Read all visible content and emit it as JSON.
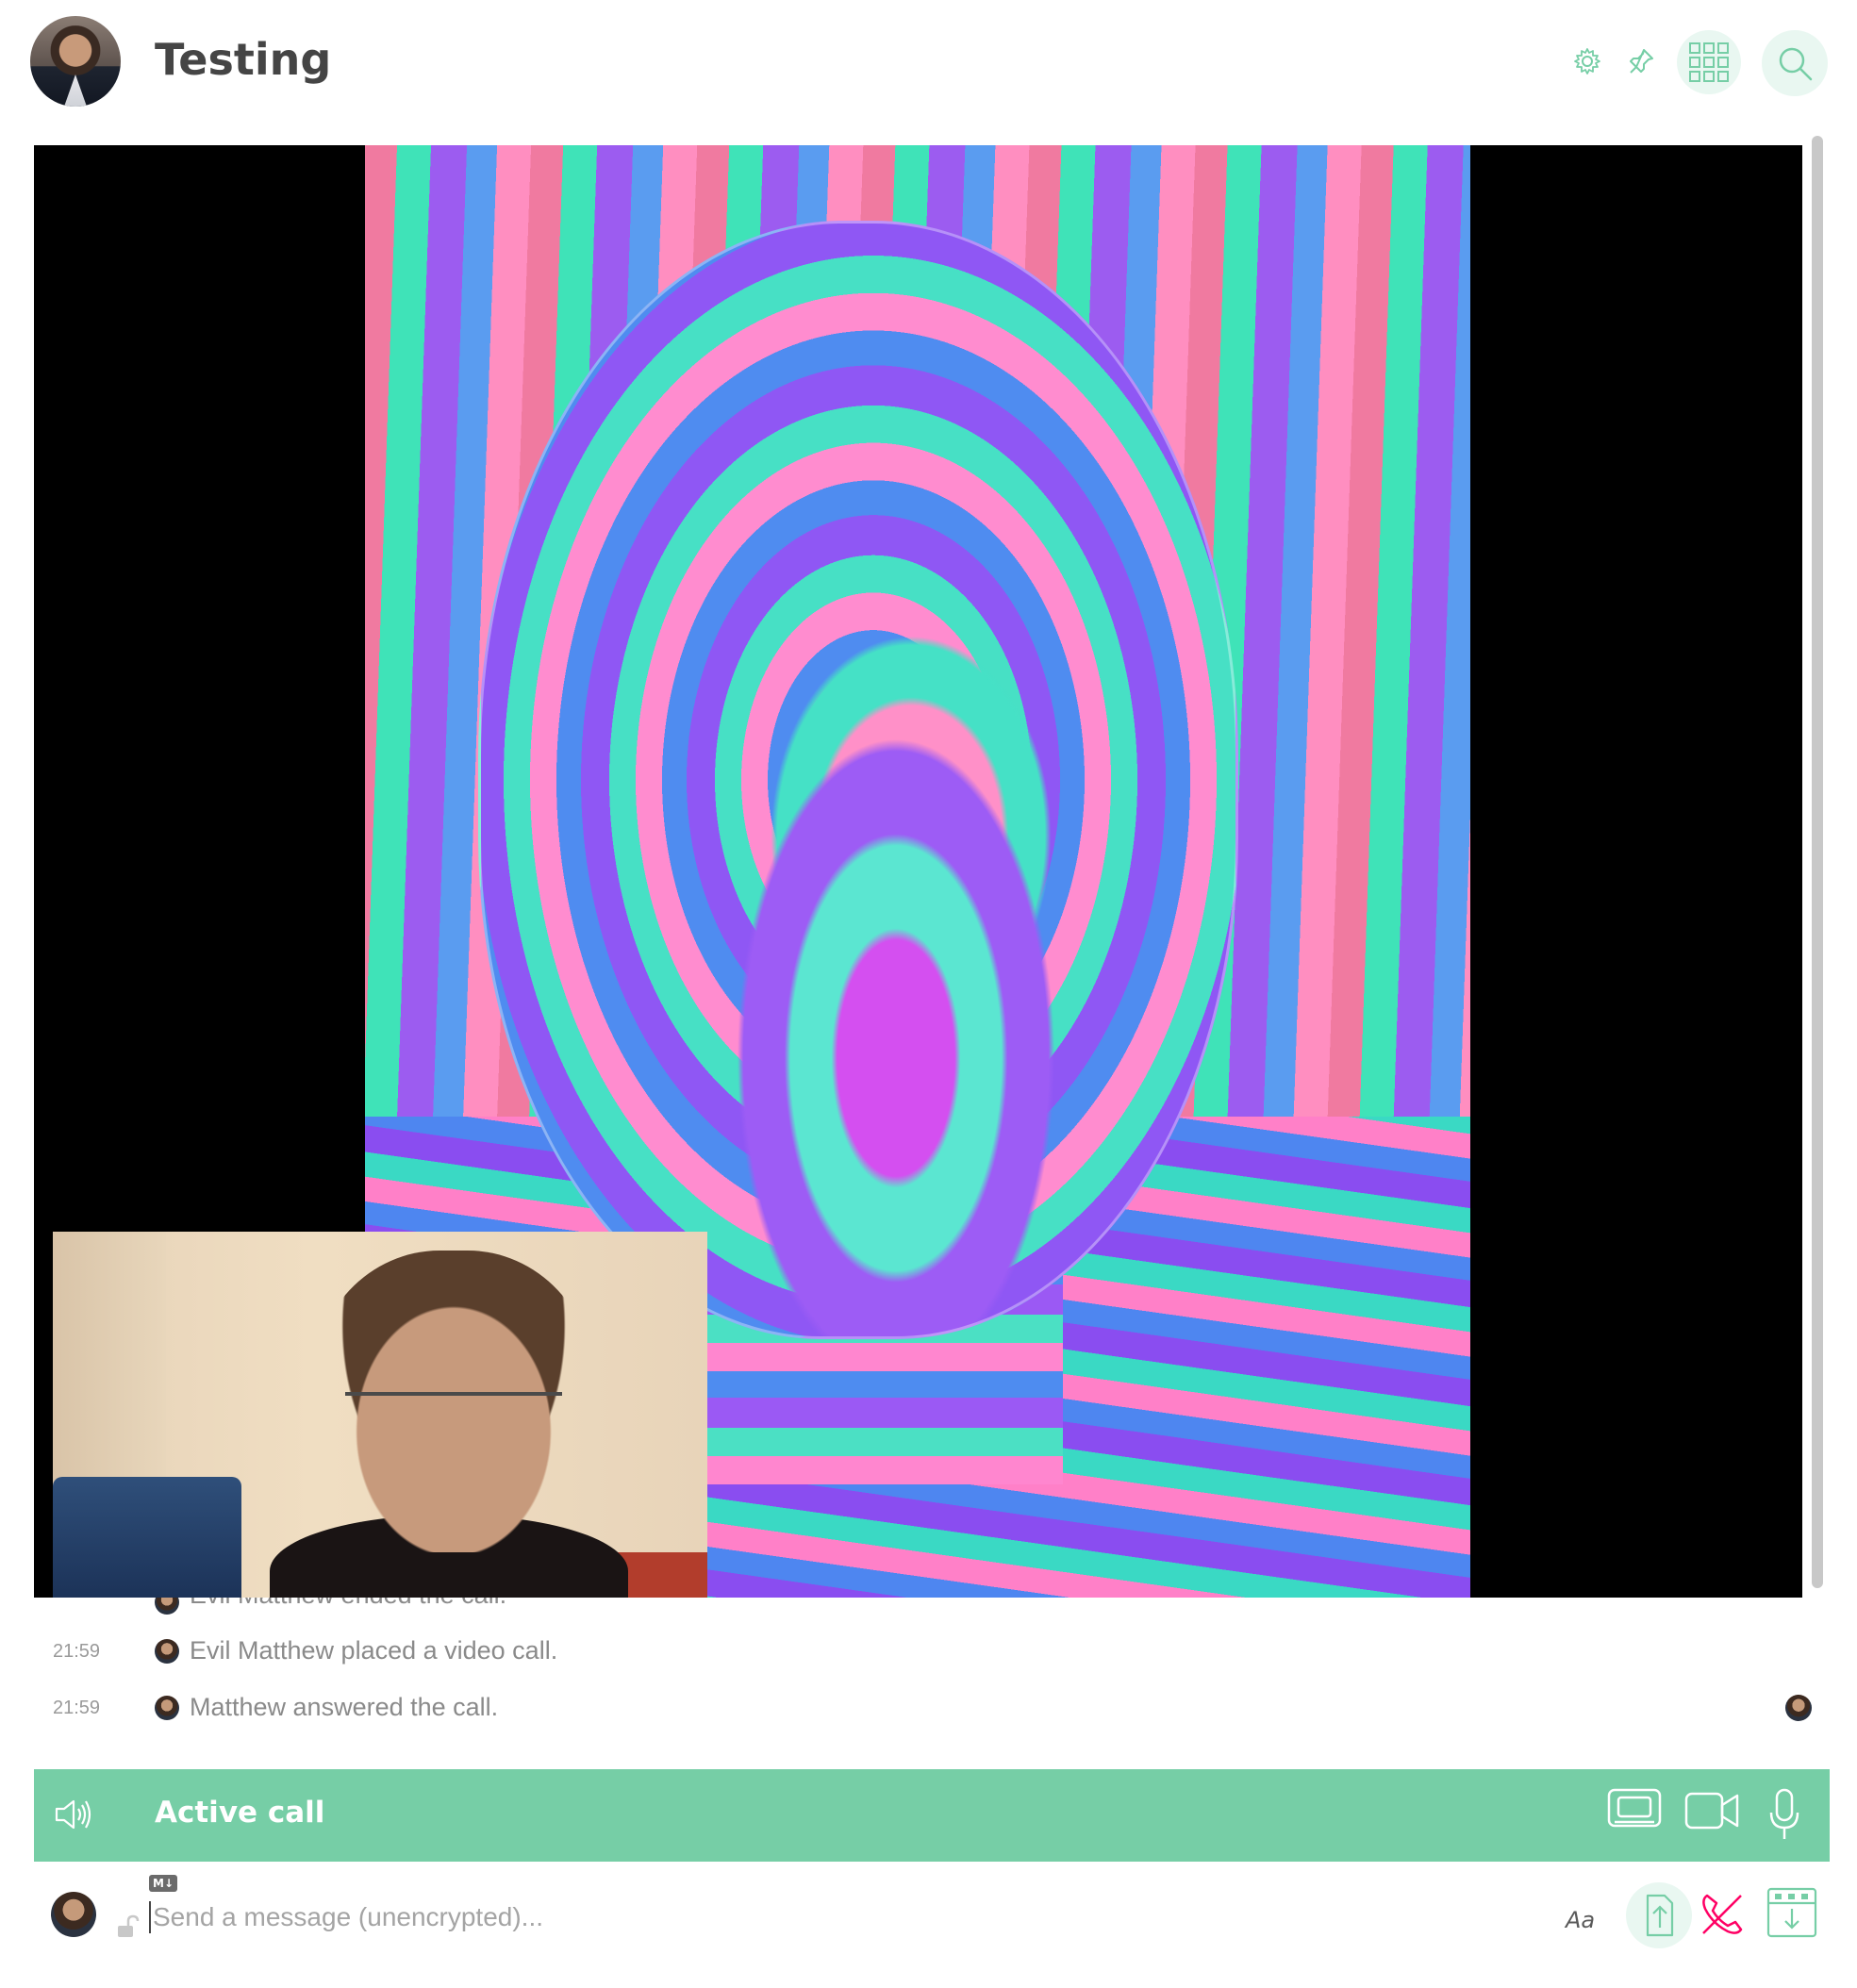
{
  "header": {
    "room_name": "Testing"
  },
  "timeline": {
    "partial_message": "Evil Matthew ended the call.",
    "events": [
      {
        "time": "21:59",
        "text": "Evil Matthew placed a video call."
      },
      {
        "time": "21:59",
        "text": "Matthew answered the call."
      }
    ]
  },
  "call_bar": {
    "label": "Active call"
  },
  "composer": {
    "placeholder": "Send a message (unencrypted)...",
    "markdown_badge": "M↓",
    "format_label": "Aa"
  },
  "colors": {
    "accent": "#76cea6",
    "accent_light": "#e9f7f1",
    "hangup": "#ff0064",
    "text": "#454545",
    "muted": "#9a9a9a"
  },
  "icons": [
    "settings-icon",
    "pin-icon",
    "apps-icon",
    "search-icon",
    "speaker-icon",
    "screenshare-icon",
    "video-icon",
    "mic-icon",
    "lock-icon",
    "upload-icon",
    "hangup-icon",
    "widget-icon"
  ]
}
